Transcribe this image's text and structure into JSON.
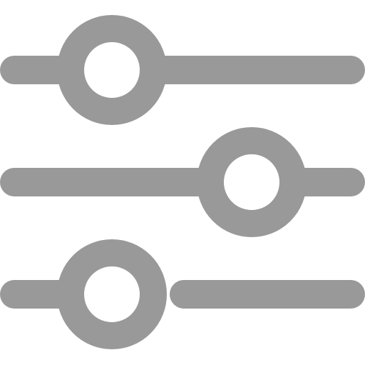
{
  "icon": {
    "name": "sliders-icon",
    "color": "#999999",
    "background": "#ffffff",
    "sliders": [
      {
        "name": "slider-top",
        "value_fraction": 0.3
      },
      {
        "name": "slider-middle",
        "value_fraction": 0.69
      },
      {
        "name": "slider-bottom",
        "value_fraction": 0.3
      }
    ]
  }
}
